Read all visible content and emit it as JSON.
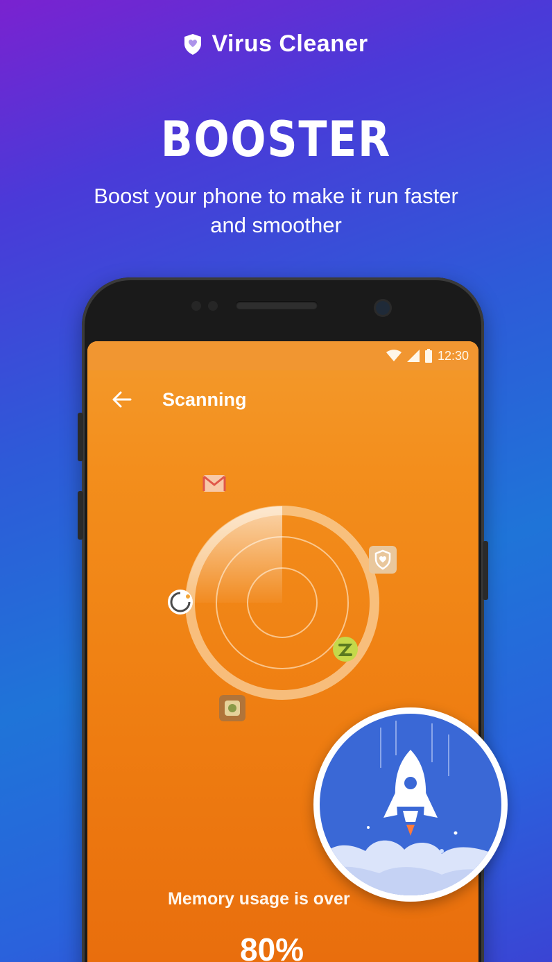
{
  "brand": {
    "name": "Virus Cleaner",
    "icon": "shield-heart-icon"
  },
  "headline": "BOOSTER",
  "subtitle": "Boost your phone to make it run faster and smoother",
  "phone": {
    "status_time": "12:30",
    "screen": {
      "title": "Scanning",
      "back_icon": "back-arrow-icon",
      "memory_label": "Memory usage is over",
      "memory_value": "80%",
      "memory_usage_percent": 80
    }
  },
  "floating_icons": [
    "mail-icon",
    "shield-app-icon",
    "circle-app-icon",
    "green-app-icon",
    "gallery-app-icon"
  ],
  "badge_icon": "rocket-icon",
  "colors": {
    "background_top": "#7a22d0",
    "background_bottom": "#1f74d8",
    "screen_orange": "#f38e1c",
    "badge_blue": "#3a68d6"
  }
}
